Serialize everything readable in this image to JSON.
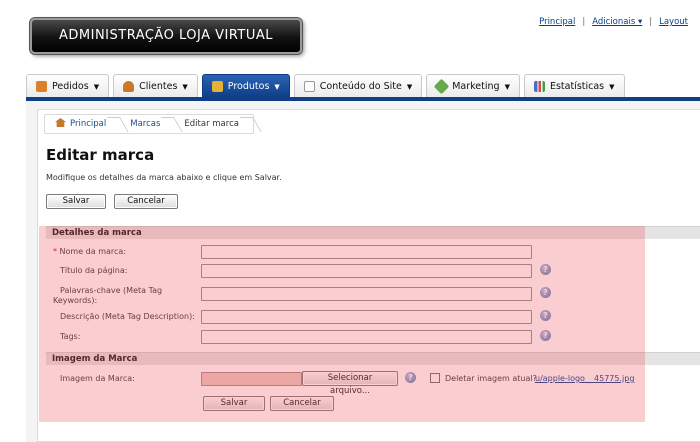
{
  "header": {
    "logo_text": "ADMINISTRAÇÃO LOJA VIRTUAL",
    "links": [
      "Principal",
      "Adicionais ▾",
      "Layout"
    ]
  },
  "tabs": [
    {
      "label": "Pedidos",
      "icon": "clipboard-icon",
      "color": "#d9822b",
      "active": false
    },
    {
      "label": "Clientes",
      "icon": "user-icon",
      "color": "#c9782a",
      "active": false
    },
    {
      "label": "Produtos",
      "icon": "box-icon",
      "color": "#e6b235",
      "active": true
    },
    {
      "label": "Conteúdo do Site",
      "icon": "document-icon",
      "color": "#cfcfcf",
      "active": false
    },
    {
      "label": "Marketing",
      "icon": "tag-icon",
      "color": "#6aa84f",
      "active": false
    },
    {
      "label": "Estatísticas",
      "icon": "bar-chart-icon",
      "color": "#4a6fc0",
      "active": false
    }
  ],
  "breadcrumb": [
    "Principal",
    "Marcas",
    "Editar marca"
  ],
  "page": {
    "title": "Editar marca",
    "description": "Modifique os detalhes da marca abaixo e clique em Salvar.",
    "save_label": "Salvar",
    "cancel_label": "Cancelar"
  },
  "sections": {
    "details": "Detalhes da marca",
    "image": "Imagem da Marca"
  },
  "fields": {
    "required_mark": "*",
    "brand_name": {
      "label": "Nome da marca:",
      "value": ""
    },
    "page_title": {
      "label": "Título da página:",
      "value": ""
    },
    "keywords": {
      "label_line1": "Palavras-chave (Meta Tag",
      "label_line2": "Keywords):",
      "value": ""
    },
    "description": {
      "label": "Descrição (Meta Tag Description):",
      "value": ""
    },
    "tags": {
      "label": "Tags:",
      "value": ""
    },
    "brand_image": {
      "label": "Imagem da Marca:",
      "select_file": "Selecionar arquivo...",
      "delete_label": "Deletar imagem atual?",
      "current_file": "u/apple-logo _ 45775.jpg"
    }
  },
  "colors": {
    "nav_blue": "#113f86",
    "highlight": "#f05a64"
  }
}
